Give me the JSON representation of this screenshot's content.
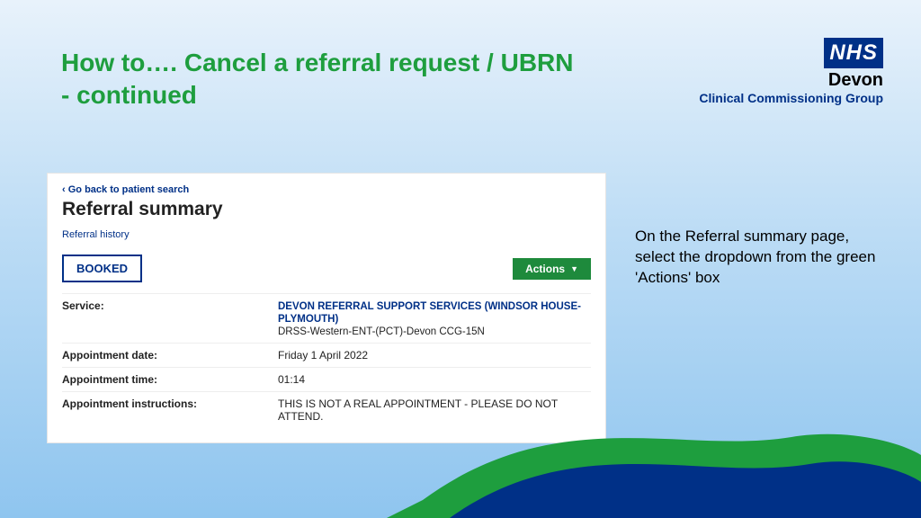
{
  "title_line1": "How to…. Cancel a referral request / UBRN",
  "title_line2": "- continued",
  "logo": {
    "nhs": "NHS",
    "devon": "Devon",
    "ccg": "Clinical Commissioning Group"
  },
  "panel": {
    "back": "Go back to patient search",
    "heading": "Referral summary",
    "history": "Referral history",
    "status": "BOOKED",
    "actions": "Actions",
    "rows": {
      "service_label": "Service:",
      "service_link": "DEVON REFERRAL SUPPORT SERVICES (WINDSOR HOUSE-PLYMOUTH)",
      "service_sub": "DRSS-Western-ENT-(PCT)-Devon CCG-15N",
      "date_label": "Appointment date:",
      "date_value": "Friday 1 April 2022",
      "time_label": "Appointment time:",
      "time_value": "01:14",
      "instr_label": "Appointment instructions:",
      "instr_value": "THIS IS NOT A REAL APPOINTMENT - PLEASE DO NOT ATTEND."
    }
  },
  "instruction": "On the Referral summary page, select the dropdown from the green 'Actions' box"
}
